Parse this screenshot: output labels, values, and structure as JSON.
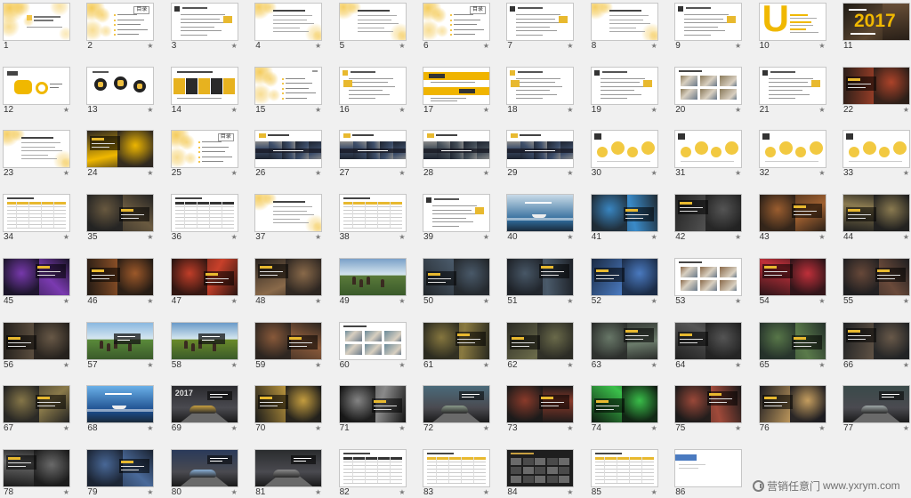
{
  "slides": [
    {
      "num": "1",
      "star": false,
      "bg": "#ffffff",
      "accent": "#f3c64a"
    },
    {
      "num": "2",
      "star": true,
      "bg": "#ffffff",
      "accent": "#f3c64a",
      "title": "目录"
    },
    {
      "num": "3",
      "star": true,
      "bg": "#ffffff",
      "accent": "#e8b92f"
    },
    {
      "num": "4",
      "star": true,
      "bg": "#ffffff",
      "accent": "#f3c64a"
    },
    {
      "num": "5",
      "star": true,
      "bg": "#ffffff",
      "accent": "#f3c64a"
    },
    {
      "num": "6",
      "star": true,
      "bg": "#ffffff",
      "accent": "#f3c64a",
      "title": "目录"
    },
    {
      "num": "7",
      "star": true,
      "bg": "#ffffff",
      "accent": "#e8b92f"
    },
    {
      "num": "8",
      "star": true,
      "bg": "#ffffff",
      "accent": "#f3c64a"
    },
    {
      "num": "9",
      "star": true,
      "bg": "#ffffff",
      "accent": "#e8b92f"
    },
    {
      "num": "10",
      "star": true,
      "bg": "#ffffff",
      "accent": "#f0b800",
      "title": "U"
    },
    {
      "num": "11",
      "star": false,
      "bg": "#1e1a14",
      "accent": "#f0b800",
      "title": "2017"
    },
    {
      "num": "12",
      "star": true,
      "bg": "#ffffff",
      "accent": "#f0b800"
    },
    {
      "num": "13",
      "star": true,
      "bg": "#ffffff",
      "accent": "#222222"
    },
    {
      "num": "14",
      "star": true,
      "bg": "#ffffff",
      "accent": "#e7b21f"
    },
    {
      "num": "15",
      "star": true,
      "bg": "#ffffff",
      "accent": "#f3c64a"
    },
    {
      "num": "16",
      "star": true,
      "bg": "#ffffff",
      "accent": "#e8b92f"
    },
    {
      "num": "17",
      "star": true,
      "bg": "#ffffff",
      "accent": "#f0b400"
    },
    {
      "num": "18",
      "star": true,
      "bg": "#ffffff",
      "accent": "#e8b92f"
    },
    {
      "num": "19",
      "star": true,
      "bg": "#ffffff",
      "accent": "#e8b92f"
    },
    {
      "num": "20",
      "star": true,
      "bg": "#ffffff",
      "accent": "#8a7a5a"
    },
    {
      "num": "21",
      "star": true,
      "bg": "#ffffff",
      "accent": "#e8b92f"
    },
    {
      "num": "22",
      "star": true,
      "bg": "#2a1e18",
      "accent": "#b0442a"
    },
    {
      "num": "23",
      "star": true,
      "bg": "#ffffff",
      "accent": "#f3c64a"
    },
    {
      "num": "24",
      "star": true,
      "bg": "#2b2520",
      "accent": "#f0b800"
    },
    {
      "num": "25",
      "star": true,
      "bg": "#ffffff",
      "accent": "#f3c64a",
      "title": "目录"
    },
    {
      "num": "26",
      "star": true,
      "bg": "#ffffff",
      "accent": "#3d4e6a"
    },
    {
      "num": "27",
      "star": true,
      "bg": "#ffffff",
      "accent": "#3d4e6a"
    },
    {
      "num": "28",
      "star": true,
      "bg": "#ffffff",
      "accent": "#46505a"
    },
    {
      "num": "29",
      "star": true,
      "bg": "#ffffff",
      "accent": "#3d4e6a"
    },
    {
      "num": "30",
      "star": true,
      "bg": "#ffffff",
      "accent": "#f0c020"
    },
    {
      "num": "31",
      "star": true,
      "bg": "#ffffff",
      "accent": "#f0c020"
    },
    {
      "num": "32",
      "star": true,
      "bg": "#ffffff",
      "accent": "#f0c020"
    },
    {
      "num": "33",
      "star": true,
      "bg": "#ffffff",
      "accent": "#f0c020"
    },
    {
      "num": "34",
      "star": true,
      "bg": "#ffffff",
      "accent": "#e8b92f"
    },
    {
      "num": "35",
      "star": true,
      "bg": "#222222",
      "accent": "#6a5a40"
    },
    {
      "num": "36",
      "star": true,
      "bg": "#ffffff",
      "accent": "#333333"
    },
    {
      "num": "37",
      "star": true,
      "bg": "#ffffff",
      "accent": "#f3c64a"
    },
    {
      "num": "38",
      "star": true,
      "bg": "#ffffff",
      "accent": "#e8b92f"
    },
    {
      "num": "39",
      "star": true,
      "bg": "#ffffff",
      "accent": "#e8b92f"
    },
    {
      "num": "40",
      "star": true,
      "bg": "#2f6a9a",
      "accent": "#c9dbe8"
    },
    {
      "num": "41",
      "star": true,
      "bg": "#1f2a33",
      "accent": "#3a8ac8"
    },
    {
      "num": "42",
      "star": true,
      "bg": "#222222",
      "accent": "#555555"
    },
    {
      "num": "43",
      "star": true,
      "bg": "#2a2018",
      "accent": "#a06030"
    },
    {
      "num": "44",
      "star": true,
      "bg": "#1e1e1e",
      "accent": "#8a7a50"
    },
    {
      "num": "45",
      "star": true,
      "bg": "#1a1428",
      "accent": "#7a3ab0"
    },
    {
      "num": "46",
      "star": true,
      "bg": "#221a14",
      "accent": "#a05a2a"
    },
    {
      "num": "47",
      "star": true,
      "bg": "#2a1410",
      "accent": "#c8402a"
    },
    {
      "num": "48",
      "star": true,
      "bg": "#2a2420",
      "accent": "#8a6a4a"
    },
    {
      "num": "49",
      "star": true,
      "bg": "#7aa0c8",
      "accent": "#5a7a3a"
    },
    {
      "num": "50",
      "star": true,
      "bg": "#22262a",
      "accent": "#4a5a6a"
    },
    {
      "num": "51",
      "star": true,
      "bg": "#1e2228",
      "accent": "#4a5a6a"
    },
    {
      "num": "52",
      "star": true,
      "bg": "#1a2a44",
      "accent": "#4a7ac0"
    },
    {
      "num": "53",
      "star": true,
      "bg": "#ffffff",
      "accent": "#8a6a4a"
    },
    {
      "num": "54",
      "star": true,
      "bg": "#2a1418",
      "accent": "#c0303a"
    },
    {
      "num": "55",
      "star": true,
      "bg": "#1e1e20",
      "accent": "#6a4a3a"
    },
    {
      "num": "56",
      "star": true,
      "bg": "#24201c",
      "accent": "#6a5a48"
    },
    {
      "num": "57",
      "star": true,
      "bg": "#8ab8e0",
      "accent": "#5a8a3a"
    },
    {
      "num": "58",
      "star": true,
      "bg": "#6a9ac8",
      "accent": "#6a8a2a"
    },
    {
      "num": "59",
      "star": true,
      "bg": "#2a2420",
      "accent": "#8a5a3a"
    },
    {
      "num": "60",
      "star": true,
      "bg": "#ffffff",
      "accent": "#6a8a9a"
    },
    {
      "num": "61",
      "star": true,
      "bg": "#2a2a20",
      "accent": "#8a7a40"
    },
    {
      "num": "62",
      "star": true,
      "bg": "#2a2a24",
      "accent": "#6a6a4a"
    },
    {
      "num": "63",
      "star": true,
      "bg": "#2a2c2a",
      "accent": "#6a7a6a"
    },
    {
      "num": "64",
      "star": true,
      "bg": "#202020",
      "accent": "#555555"
    },
    {
      "num": "65",
      "star": true,
      "bg": "#24302a",
      "accent": "#5a7a4a"
    },
    {
      "num": "66",
      "star": true,
      "bg": "#202224",
      "accent": "#6a5a4a"
    },
    {
      "num": "67",
      "star": true,
      "bg": "#222222",
      "accent": "#8a7a4a"
    },
    {
      "num": "68",
      "star": true,
      "bg": "#1a4a8a",
      "accent": "#6ab0e8"
    },
    {
      "num": "69",
      "star": true,
      "bg": "#2a2a2e",
      "accent": "#c8a040",
      "title": "2017"
    },
    {
      "num": "70",
      "star": true,
      "bg": "#1a1a1a",
      "accent": "#c8a040"
    },
    {
      "num": "71",
      "star": true,
      "bg": "#141414",
      "accent": "#8a8a8a"
    },
    {
      "num": "72",
      "star": true,
      "bg": "#4a6a7a",
      "accent": "#8a9a8a"
    },
    {
      "num": "73",
      "star": true,
      "bg": "#1a1a1a",
      "accent": "#8a3a2a"
    },
    {
      "num": "74",
      "star": true,
      "bg": "#0e1a10",
      "accent": "#3ac04a"
    },
    {
      "num": "75",
      "star": true,
      "bg": "#1a1a1a",
      "accent": "#a04a3a"
    },
    {
      "num": "76",
      "star": true,
      "bg": "#1a1a20",
      "accent": "#c8a060"
    },
    {
      "num": "77",
      "star": true,
      "bg": "#3a4a4a",
      "accent": "#a0a8a8"
    },
    {
      "num": "78",
      "star": true,
      "bg": "#1a1a1a",
      "accent": "#6a6a6a"
    },
    {
      "num": "79",
      "star": true,
      "bg": "#1a2230",
      "accent": "#4a6a9a"
    },
    {
      "num": "80",
      "star": true,
      "bg": "#2a3a5a",
      "accent": "#8ab0d8"
    },
    {
      "num": "81",
      "star": true,
      "bg": "#2a2c2e",
      "accent": "#8a8a8a"
    },
    {
      "num": "82",
      "star": true,
      "bg": "#ffffff",
      "accent": "#333333"
    },
    {
      "num": "83",
      "star": true,
      "bg": "#ffffff",
      "accent": "#e8b92f"
    },
    {
      "num": "84",
      "star": true,
      "bg": "#1e1e1e",
      "accent": "#c8a040"
    },
    {
      "num": "85",
      "star": true,
      "bg": "#ffffff",
      "accent": "#e8b92f"
    },
    {
      "num": "86",
      "star": false,
      "bg": "#ffffff",
      "accent": "#4a7ac0"
    }
  ],
  "watermark": {
    "brand": "营销任意门",
    "url": "www.yxrym.com",
    "icon": "watermark-logo-icon"
  }
}
